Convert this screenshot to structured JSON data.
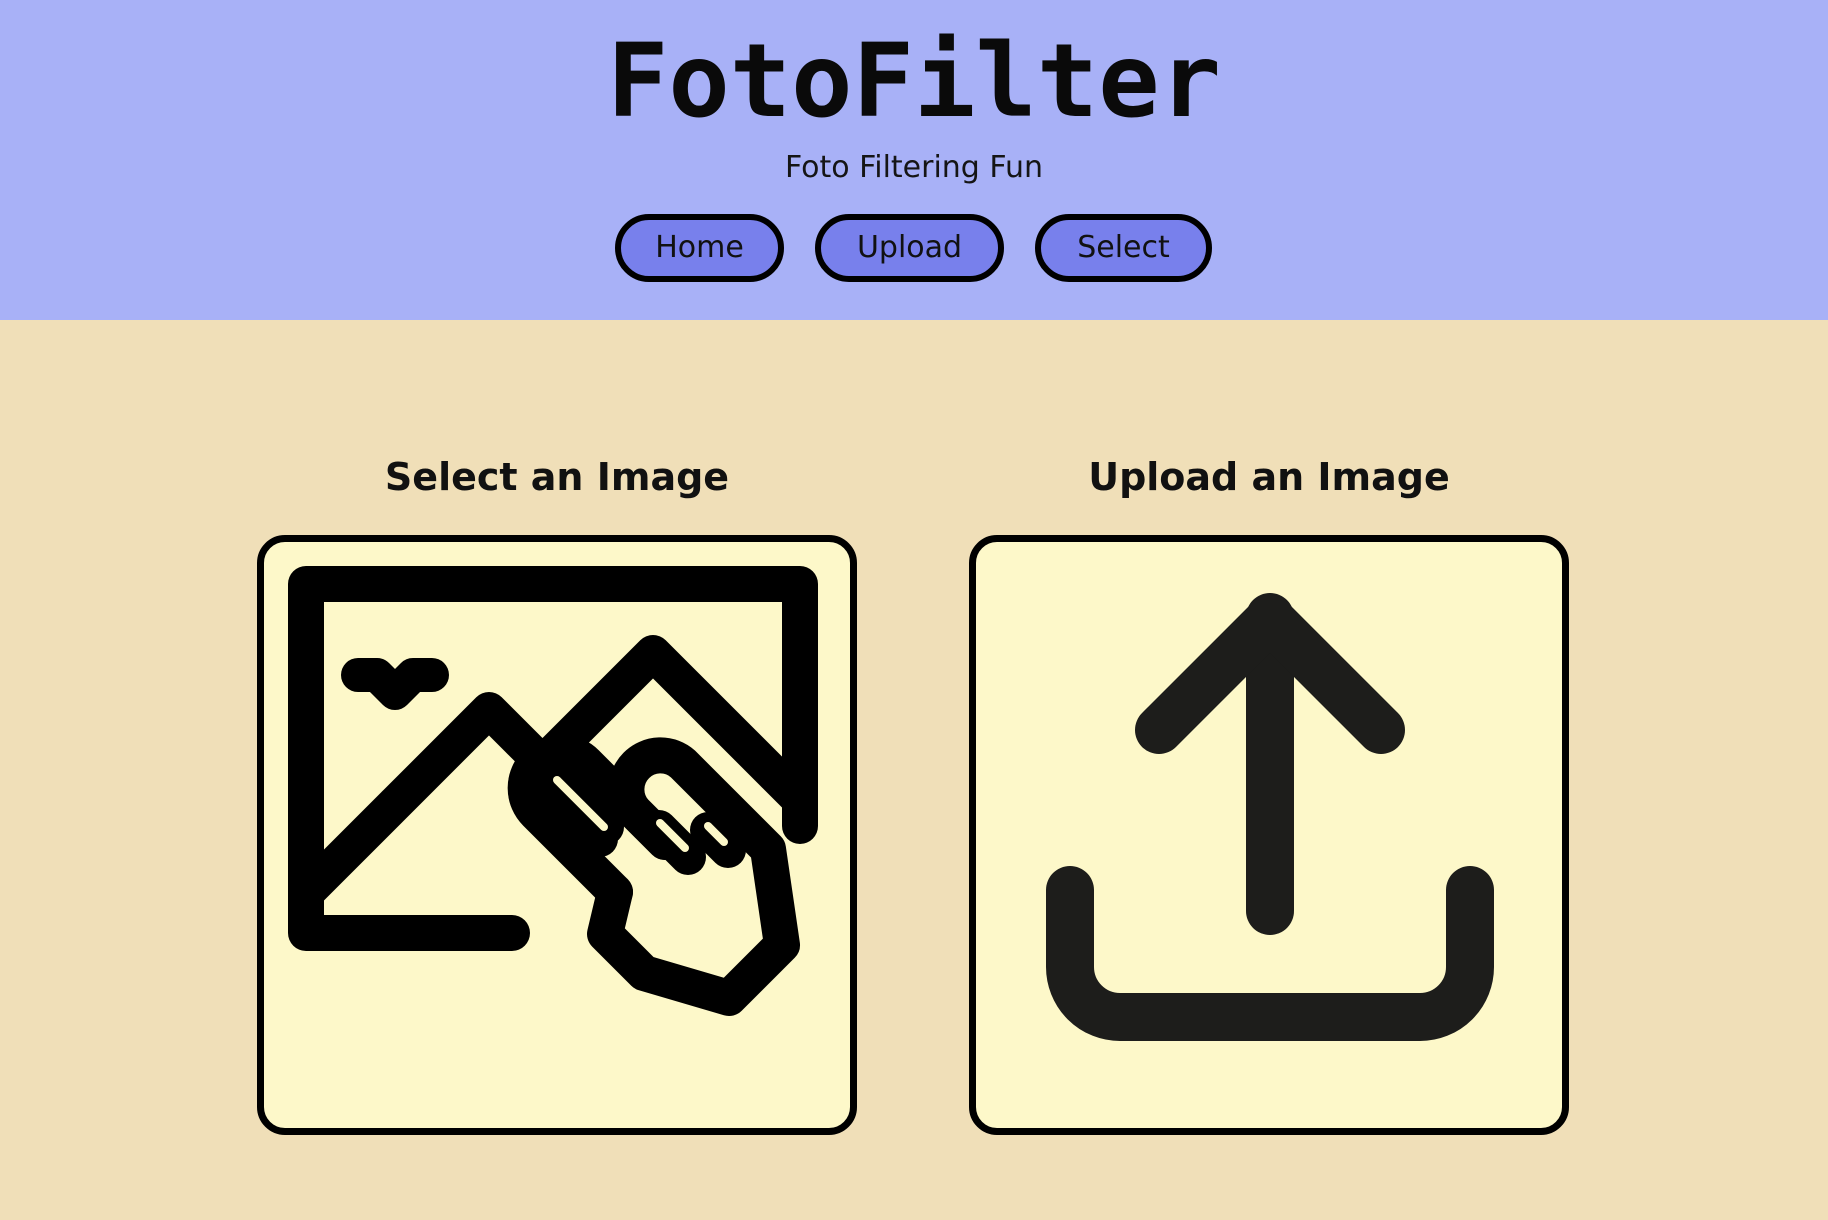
{
  "header": {
    "title": "FotoFilter",
    "subtitle": "Foto Filtering Fun",
    "background_color": "#a8b1f7"
  },
  "nav": {
    "items": [
      {
        "label": "Home"
      },
      {
        "label": "Upload"
      },
      {
        "label": "Select"
      }
    ],
    "button_color": "#7880ec"
  },
  "main": {
    "background_color": "#f0dfb8",
    "select_card": {
      "title": "Select an Image",
      "icon": "image-select-hand-icon"
    },
    "upload_card": {
      "title": "Upload an Image",
      "icon": "upload-icon"
    },
    "card_color": "#fdf8c9"
  }
}
